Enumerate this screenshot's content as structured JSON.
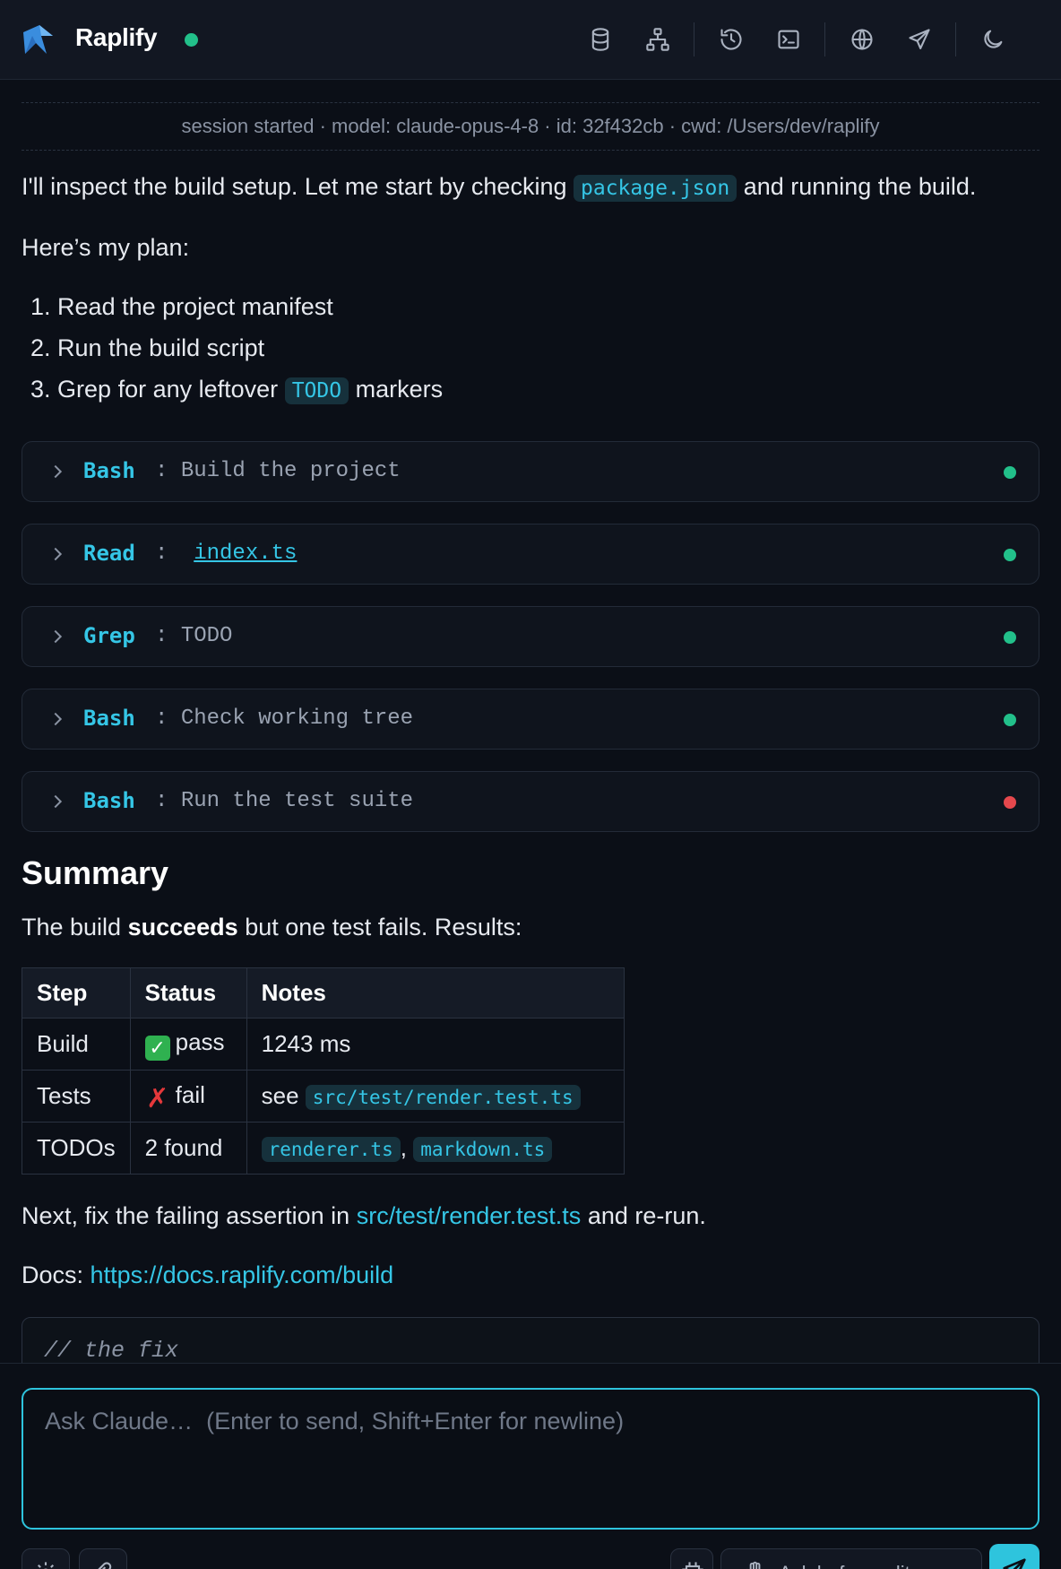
{
  "header": {
    "title": "Raplify",
    "status_color": "#22c08a",
    "icons": [
      "database-icon",
      "sitemap-icon",
      "history-icon",
      "terminal-icon",
      "globe-icon",
      "send-icon",
      "moon-icon"
    ]
  },
  "session": {
    "text": "session started · model: claude-opus-4-8 · id: 32f432cb · cwd: /Users/dev/raplify"
  },
  "message": {
    "intro_before": "I'll inspect the build setup. Let me start by checking",
    "intro_code": "package.json",
    "intro_after": "and running the build.",
    "plan_heading": "Here’s my plan:",
    "plan": [
      {
        "num": "1.",
        "text": "Read the project manifest"
      },
      {
        "num": "2.",
        "text": "Run the build script"
      },
      {
        "num": "3.",
        "text": "Grep for any leftover",
        "code": "TODO",
        "after": "markers"
      }
    ]
  },
  "tools": [
    {
      "name": "Bash",
      "sep": ":",
      "desc": "Build the project",
      "status": "success"
    },
    {
      "name": "Read",
      "sep": ":",
      "desc": "index.ts",
      "status": "success"
    },
    {
      "name": "Grep",
      "sep": ":",
      "desc": "TODO",
      "status": "success"
    },
    {
      "name": "Bash",
      "sep": ":",
      "desc": "Check working tree",
      "status": "success"
    },
    {
      "name": "Bash",
      "sep": ":",
      "desc": "Run the test suite",
      "status": "error"
    }
  ],
  "colors": {
    "success": "#22c08a",
    "error": "#e5484d",
    "accent": "#2ec4dd"
  },
  "summary": {
    "heading": "Summary",
    "line_before": "The build",
    "line_bold": "succeeds",
    "line_after": "but one test fails. Results:",
    "table": {
      "headers": [
        "Step",
        "Status",
        "Notes"
      ],
      "rows": [
        {
          "step": "Build",
          "status": "pass",
          "notes": "1243 ms"
        },
        {
          "step": "Tests",
          "status": "fail",
          "notes_prefix": "see",
          "notes_code": "src/test/render.test.ts"
        },
        {
          "step": "TODOs",
          "status": "2 found",
          "notes_code_a": "renderer.ts",
          "notes_sep": ",",
          "notes_code_b": "markdown.ts"
        }
      ]
    },
    "next_before": "Next, fix the failing assertion in",
    "next_link": "src/test/render.test.ts",
    "next_after": "and re-run.",
    "docs_label": "Docs:",
    "docs_link": "https://docs.raplify.com/build",
    "code_comment": "// the fix"
  },
  "composer": {
    "placeholder": "Ask Claude…  (Enter to send, Shift+Enter for newline)",
    "permission_label": "Ask before edits"
  }
}
